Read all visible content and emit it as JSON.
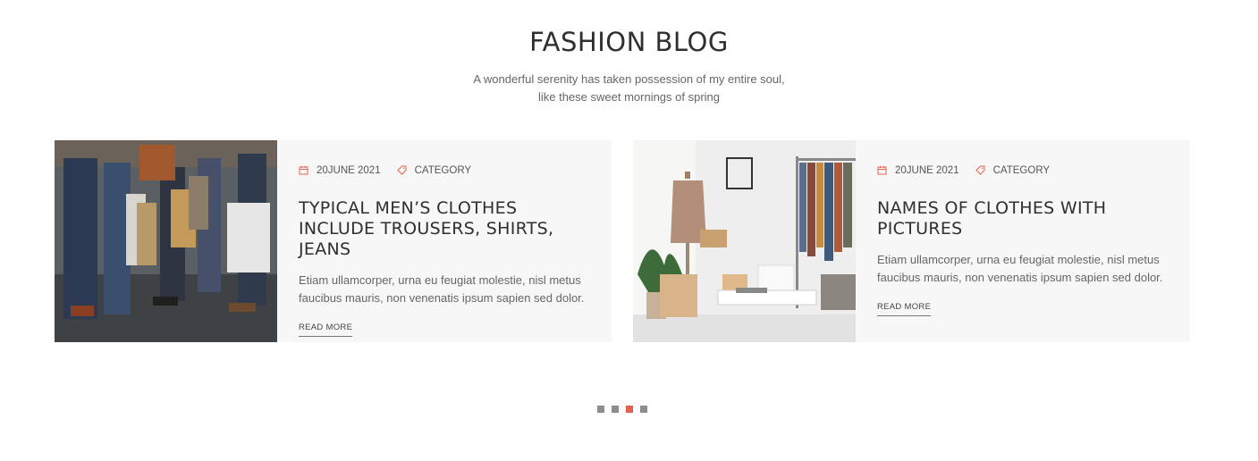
{
  "section": {
    "title": "FASHION BLOG",
    "subtitle_line1": "A wonderful serenity has taken possession of my entire soul,",
    "subtitle_line2": "like these sweet mornings of spring"
  },
  "posts": [
    {
      "date": "20JUNE 2021",
      "category": "CATEGORY",
      "title": "TYPICAL MEN’S CLOTHES INCLUDE TROUSERS, SHIRTS, JEANS",
      "excerpt": "Etiam ullamcorper, urna eu feugiat molestie, nisl metus faucibus mauris, non venenatis ipsum sapien sed dolor.",
      "read_more": "READ MORE",
      "image": "shoppers-with-bags-photo"
    },
    {
      "date": "20JUNE 2021",
      "category": "CATEGORY",
      "title": "NAMES OF CLOTHES WITH PICTURES",
      "excerpt": "Etiam ullamcorper, urna eu feugiat molestie, nisl metus faucibus mauris, non venenatis ipsum sapien sed dolor.",
      "read_more": "READ MORE",
      "image": "clothing-rack-room-photo"
    }
  ],
  "icons": {
    "date": "calendar-icon",
    "category": "tag-icon"
  },
  "colors": {
    "accent": "#e8604c",
    "card_bg": "#f7f7f7",
    "dot_inactive": "#8d8d8d"
  },
  "pagination": {
    "count": 4,
    "active_index": 2
  }
}
